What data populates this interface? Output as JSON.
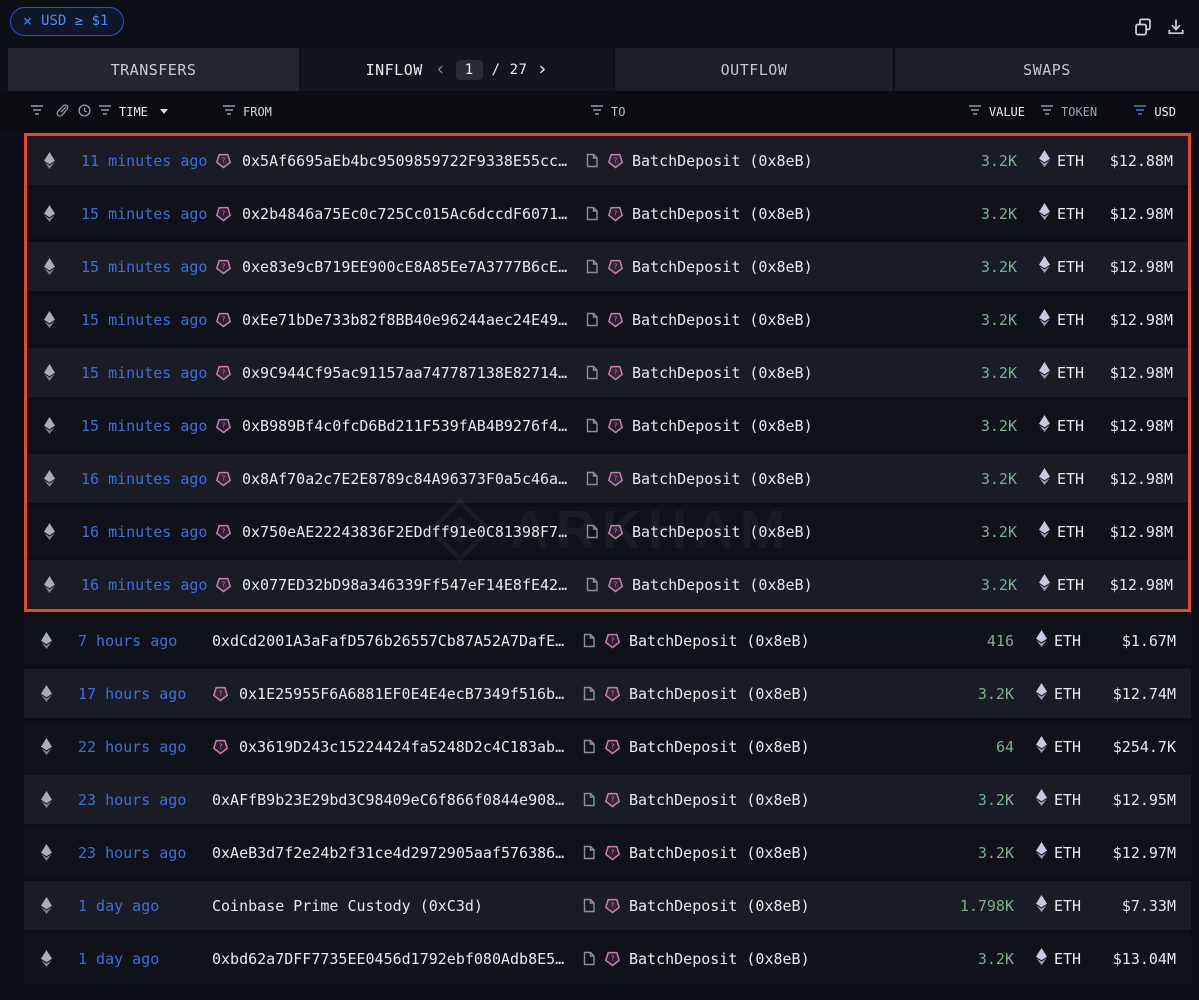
{
  "toolbar": {
    "filter_chip": {
      "close": "×",
      "label": "USD ≥ $1"
    }
  },
  "tabs": {
    "transfers": {
      "label": "TRANSFERS"
    },
    "inflow": {
      "label": "INFLOW"
    },
    "outflow": {
      "label": "OUTFLOW"
    },
    "swaps": {
      "label": "SWAPS"
    },
    "pagination": {
      "prev": "‹",
      "current": "1",
      "separator": "/",
      "total": "27",
      "next": "›"
    }
  },
  "table": {
    "headers": {
      "time": "TIME",
      "from": "FROM",
      "to": "TO",
      "value": "VALUE",
      "token": "TOKEN",
      "usd": "USD"
    },
    "rows": [
      {
        "time": "11 minutes ago",
        "from": "0x5Af6695aEb4bc9509859722F9338E55cc…",
        "from_entity_icon": true,
        "to": "BatchDeposit (0x8eB)",
        "value": "3.2K",
        "token": "ETH",
        "usd": "$12.88M",
        "highlighted": true
      },
      {
        "time": "15 minutes ago",
        "from": "0x2b4846a75Ec0c725Cc015Ac6dccdF6071…",
        "from_entity_icon": true,
        "to": "BatchDeposit (0x8eB)",
        "value": "3.2K",
        "token": "ETH",
        "usd": "$12.98M",
        "highlighted": true
      },
      {
        "time": "15 minutes ago",
        "from": "0xe83e9cB719EE900cE8A85Ee7A3777B6cE…",
        "from_entity_icon": true,
        "to": "BatchDeposit (0x8eB)",
        "value": "3.2K",
        "token": "ETH",
        "usd": "$12.98M",
        "highlighted": true
      },
      {
        "time": "15 minutes ago",
        "from": "0xEe71bDe733b82f8BB40e96244aec24E49…",
        "from_entity_icon": true,
        "to": "BatchDeposit (0x8eB)",
        "value": "3.2K",
        "token": "ETH",
        "usd": "$12.98M",
        "highlighted": true
      },
      {
        "time": "15 minutes ago",
        "from": "0x9C944Cf95ac91157aa747787138E82714…",
        "from_entity_icon": true,
        "to": "BatchDeposit (0x8eB)",
        "value": "3.2K",
        "token": "ETH",
        "usd": "$12.98M",
        "highlighted": true
      },
      {
        "time": "15 minutes ago",
        "from": "0xB989Bf4c0fcD6Bd211F539fAB4B9276f4…",
        "from_entity_icon": true,
        "to": "BatchDeposit (0x8eB)",
        "value": "3.2K",
        "token": "ETH",
        "usd": "$12.98M",
        "highlighted": true
      },
      {
        "time": "16 minutes ago",
        "from": "0x8Af70a2c7E2E8789c84A96373F0a5c46a…",
        "from_entity_icon": true,
        "to": "BatchDeposit (0x8eB)",
        "value": "3.2K",
        "token": "ETH",
        "usd": "$12.98M",
        "highlighted": true
      },
      {
        "time": "16 minutes ago",
        "from": "0x750eAE22243836F2EDdff91e0C81398F7…",
        "from_entity_icon": true,
        "to": "BatchDeposit (0x8eB)",
        "value": "3.2K",
        "token": "ETH",
        "usd": "$12.98M",
        "highlighted": true
      },
      {
        "time": "16 minutes ago",
        "from": "0x077ED32bD98a346339Ff547eF14E8fE42…",
        "from_entity_icon": true,
        "to": "BatchDeposit (0x8eB)",
        "value": "3.2K",
        "token": "ETH",
        "usd": "$12.98M",
        "highlighted": true
      },
      {
        "time": "7 hours ago",
        "from": "0xdCd2001A3aFafD576b26557Cb87A52A7DafE…",
        "from_entity_icon": false,
        "to": "BatchDeposit (0x8eB)",
        "value": "416",
        "token": "ETH",
        "usd": "$1.67M",
        "highlighted": false
      },
      {
        "time": "17 hours ago",
        "from": "0x1E25955F6A6881EF0E4E4ecB7349f516b…",
        "from_entity_icon": true,
        "to": "BatchDeposit (0x8eB)",
        "value": "3.2K",
        "token": "ETH",
        "usd": "$12.74M",
        "highlighted": false
      },
      {
        "time": "22 hours ago",
        "from": "0x3619D243c15224424fa5248D2c4C183ab…",
        "from_entity_icon": true,
        "to": "BatchDeposit (0x8eB)",
        "value": "64",
        "token": "ETH",
        "usd": "$254.7K",
        "highlighted": false
      },
      {
        "time": "23 hours ago",
        "from": "0xAFfB9b23E29bd3C98409eC6f866f0844e908…",
        "from_entity_icon": false,
        "to": "BatchDeposit (0x8eB)",
        "value": "3.2K",
        "token": "ETH",
        "usd": "$12.95M",
        "highlighted": false
      },
      {
        "time": "23 hours ago",
        "from": "0xAeB3d7f2e24b2f31ce4d2972905aaf576386…",
        "from_entity_icon": false,
        "to": "BatchDeposit (0x8eB)",
        "value": "3.2K",
        "token": "ETH",
        "usd": "$12.97M",
        "highlighted": false
      },
      {
        "time": "1 day ago",
        "from": "Coinbase Prime Custody (0xC3d)",
        "from_entity_icon": false,
        "to": "BatchDeposit (0x8eB)",
        "value": "1.798K",
        "token": "ETH",
        "usd": "$7.33M",
        "highlighted": false
      },
      {
        "time": "1 day ago",
        "from": "0xbd62a7DFF7735EE0456d1792ebf080Adb8E5…",
        "from_entity_icon": false,
        "to": "BatchDeposit (0x8eB)",
        "value": "3.2K",
        "token": "ETH",
        "usd": "$13.04M",
        "highlighted": false
      }
    ]
  },
  "watermark": {
    "text": "ARKHAM"
  },
  "colors": {
    "highlight_border": "#e8482a",
    "accent_blue": "#4e8af2",
    "time_blue": "#3e6edc",
    "value_green": "#7fae8d",
    "entity_purple": "#c77fae"
  }
}
